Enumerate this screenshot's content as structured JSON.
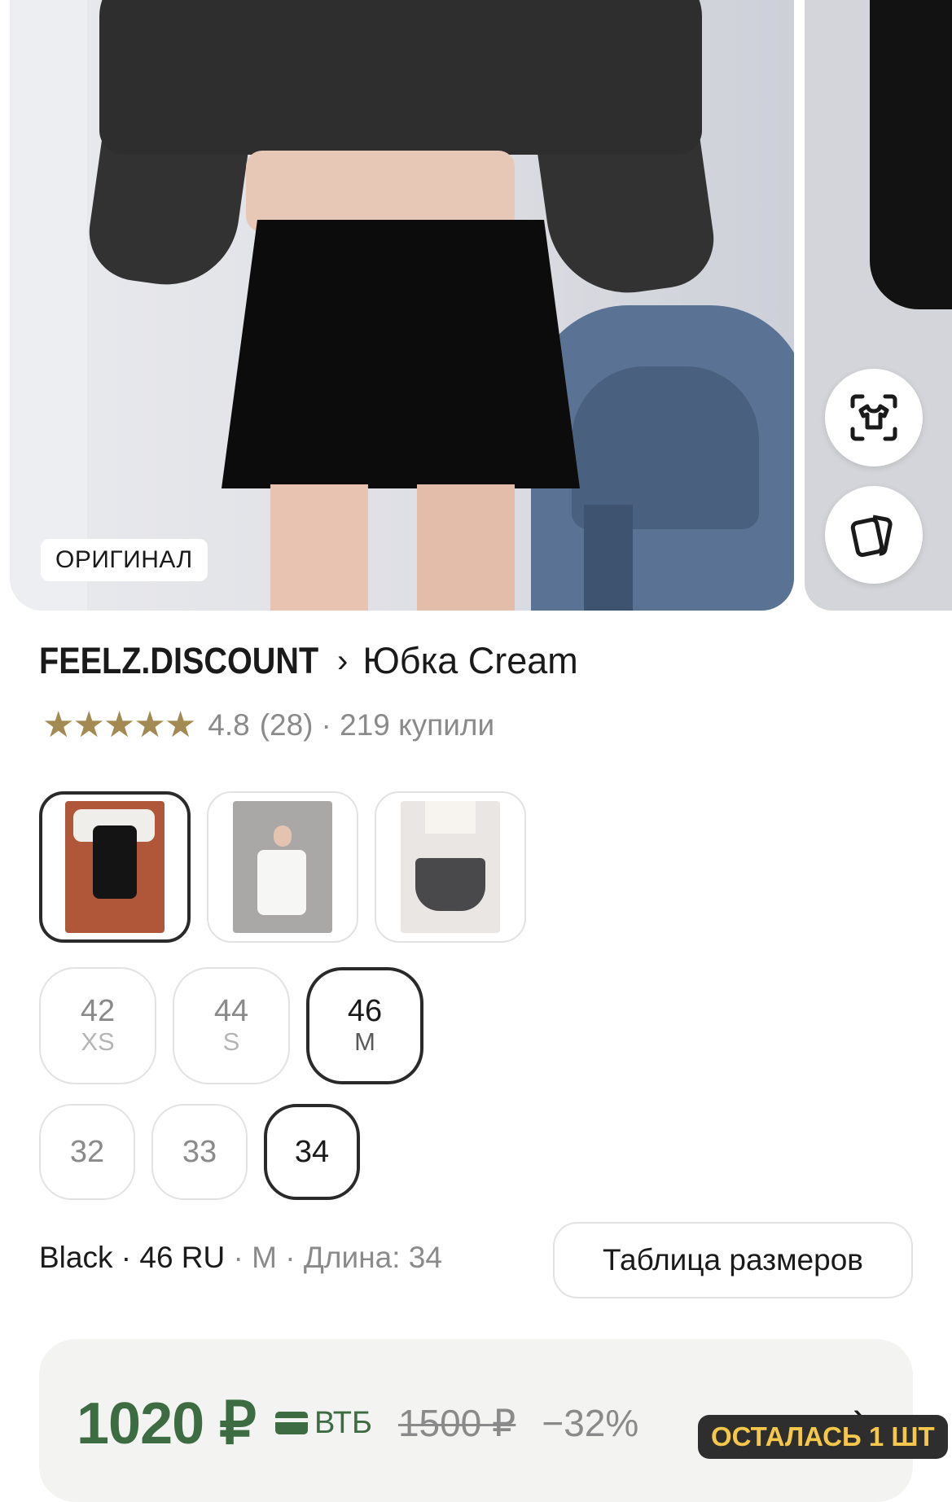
{
  "gallery": {
    "badge": "ОРИГИНАЛ",
    "buttons": {
      "try_on_icon": "tshirt-scan-icon",
      "compare_icon": "cards-icon"
    }
  },
  "product": {
    "brand": "FEELZ.DISCOUNT",
    "separator": "›",
    "name": "Юбка Cream"
  },
  "rating": {
    "stars": 5,
    "value": "4.8",
    "reviews": "(28)",
    "bought": "· 219 купили",
    "star_color": "#a38a52"
  },
  "colors": [
    {
      "name": "Black",
      "selected": true
    },
    {
      "name": "White",
      "selected": false
    },
    {
      "name": "Grey",
      "selected": false
    }
  ],
  "sizes": [
    {
      "num": "42",
      "sub": "XS",
      "selected": false
    },
    {
      "num": "44",
      "sub": "S",
      "selected": false
    },
    {
      "num": "46",
      "sub": "M",
      "selected": true
    }
  ],
  "lengths": [
    {
      "num": "32",
      "selected": false
    },
    {
      "num": "33",
      "selected": false
    },
    {
      "num": "34",
      "selected": true
    }
  ],
  "summary": {
    "color": "Black",
    "dot1": " · ",
    "size_ru": "46 RU",
    "dot2": " · ",
    "size_letter": "M",
    "dot3": " · ",
    "length": "Длина: 34"
  },
  "size_table_label": "Таблица размеров",
  "price": {
    "current": "1020 ₽",
    "bank": "ВТБ",
    "old": "1500 ₽",
    "discount": "−32%",
    "stock": "ОСТАЛАСЬ 1 ШТ",
    "accent": "#3d6b42",
    "stock_color": "#f5c84c"
  }
}
